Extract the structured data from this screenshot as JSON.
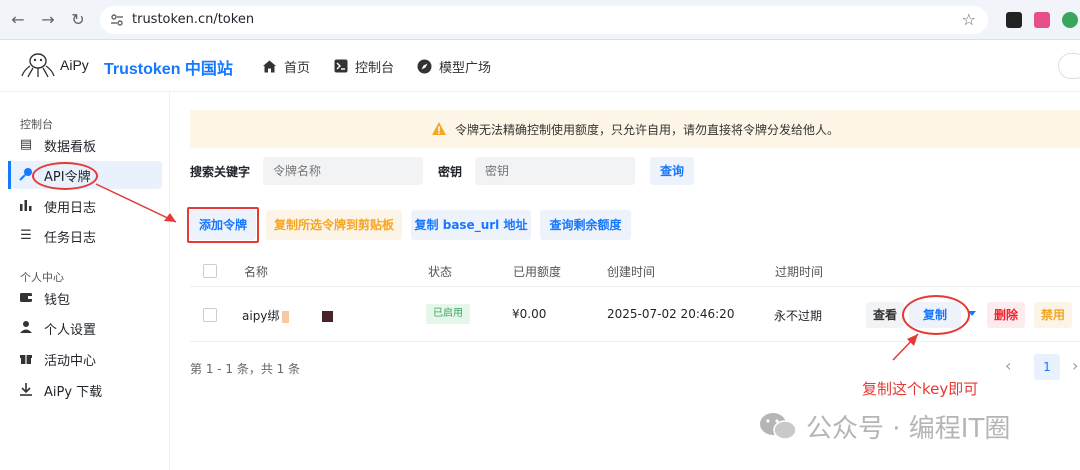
{
  "browser": {
    "url": "trustoken.cn/token",
    "back_icon": "arrow-left",
    "forward_icon": "arrow-right",
    "reload_icon": "reload",
    "star_icon": "star"
  },
  "header": {
    "logo_text": "AiPy",
    "site_title": "Trustoken 中国站",
    "nav": [
      {
        "label": "首页",
        "icon": "home-icon"
      },
      {
        "label": "控制台",
        "icon": "terminal-icon"
      },
      {
        "label": "模型广场",
        "icon": "compass-icon"
      }
    ]
  },
  "sidebar": {
    "group1": "控制台",
    "group2": "个人中心",
    "items": [
      {
        "label": "数据看板",
        "icon": "dashboard-icon"
      },
      {
        "label": "API令牌",
        "icon": "key-icon",
        "active": true
      },
      {
        "label": "使用日志",
        "icon": "bar-chart-icon"
      },
      {
        "label": "任务日志",
        "icon": "list-icon"
      },
      {
        "label": "钱包",
        "icon": "wallet-icon"
      },
      {
        "label": "个人设置",
        "icon": "user-icon"
      },
      {
        "label": "活动中心",
        "icon": "gift-icon"
      },
      {
        "label": "AiPy 下载",
        "icon": "download-icon"
      }
    ]
  },
  "notice": {
    "text": "令牌无法精确控制使用额度，只允许自用，请勿直接将令牌分发给他人。",
    "color": "#fdf6e6"
  },
  "search": {
    "keyword_label": "搜索关键字",
    "keyword_placeholder": "令牌名称",
    "secret_label": "密钥",
    "secret_placeholder": "密钥",
    "query_button": "查询"
  },
  "actions": {
    "add": "添加令牌",
    "copy_selected": "复制所选令牌到剪贴板",
    "copy_base_url": "复制 base_url 地址",
    "query_balance": "查询剩余额度"
  },
  "table": {
    "columns": [
      "名称",
      "状态",
      "已用额度",
      "创建时间",
      "过期时间"
    ],
    "rows": [
      {
        "name": "aipy绑",
        "status": "已启用",
        "used": "¥0.00",
        "created": "2025-07-02 20:46:20",
        "expires": "永不过期",
        "ops": {
          "view": "查看",
          "copy": "复制",
          "delete": "删除",
          "disable": "禁用"
        }
      }
    ]
  },
  "pagination": {
    "info": "第 1 - 1 条，共 1 条",
    "current_page": "1"
  },
  "annotation": {
    "text": "复制这个key即可",
    "color": "#e53935"
  },
  "watermark": {
    "text": "公众号 · 编程IT圈"
  },
  "colors": {
    "accent": "#1677ff",
    "orange": "#f5a623",
    "danger": "#f5222d",
    "success": "#3aa55d"
  }
}
